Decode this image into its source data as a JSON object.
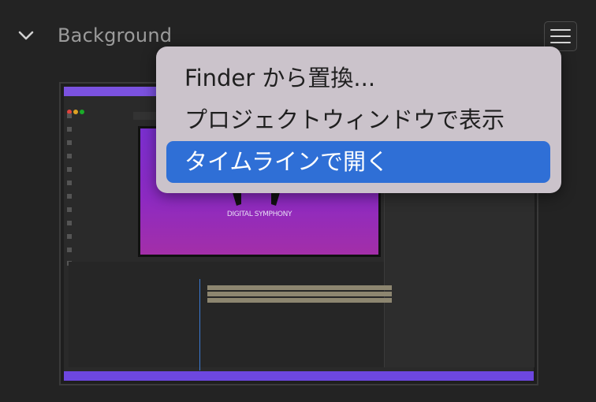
{
  "panel": {
    "title": "Background",
    "chevron_icon": "chevron-down-icon",
    "menu_icon": "hamburger-menu-icon"
  },
  "thumbnail": {
    "logo_text": "DIGITAL SYMPHONY",
    "accent": "#7b52e0"
  },
  "context_menu": {
    "items": [
      {
        "label": "Finder から置換..."
      },
      {
        "label": "プロジェクトウィンドウで表示"
      },
      {
        "label": "タイムラインで開く",
        "highlighted": true
      }
    ],
    "highlight_color": "#2f6fd6"
  }
}
